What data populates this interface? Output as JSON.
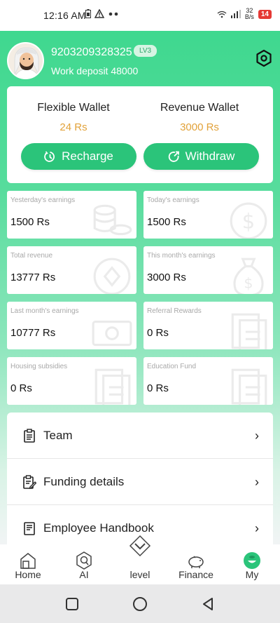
{
  "status_bar": {
    "time": "12:16 AM",
    "net_speed_value": "32",
    "net_speed_unit": "B/s",
    "battery": "14"
  },
  "profile": {
    "phone": "9203209328325",
    "level_badge": "LV3",
    "work_deposit": "Work deposit 48000"
  },
  "wallet": {
    "flexible_label": "Flexible Wallet",
    "flexible_value": "24 Rs",
    "revenue_label": "Revenue Wallet",
    "revenue_value": "3000 Rs",
    "recharge_label": "Recharge",
    "withdraw_label": "Withdraw"
  },
  "stats": [
    {
      "label": "Yesterday's earnings",
      "value": "1500 Rs"
    },
    {
      "label": "Today's earnings",
      "value": "1500 Rs"
    },
    {
      "label": "Total revenue",
      "value": "13777 Rs"
    },
    {
      "label": "This month's earnings",
      "value": "3000 Rs"
    },
    {
      "label": "Last month's earnings",
      "value": "10777 Rs"
    },
    {
      "label": "Referral Rewards",
      "value": "0 Rs"
    },
    {
      "label": "Housing subsidies",
      "value": "0 Rs"
    },
    {
      "label": "Education Fund",
      "value": "0 Rs"
    }
  ],
  "menu": [
    {
      "label": "Team",
      "icon": "clipboard-list-icon"
    },
    {
      "label": "Funding details",
      "icon": "document-edit-icon"
    },
    {
      "label": "Employee Handbook",
      "icon": "handbook-icon"
    }
  ],
  "tabs": [
    {
      "label": "Home",
      "icon": "home-icon"
    },
    {
      "label": "AI",
      "icon": "ai-icon"
    },
    {
      "label": "level",
      "icon": "level-icon"
    },
    {
      "label": "Finance",
      "icon": "piggy-bank-icon"
    },
    {
      "label": "My",
      "icon": "user-icon",
      "active": true
    }
  ],
  "colors": {
    "brand_green": "#2bc47a",
    "wallet_value": "#e2a23a",
    "battery_low": "#e53935"
  }
}
